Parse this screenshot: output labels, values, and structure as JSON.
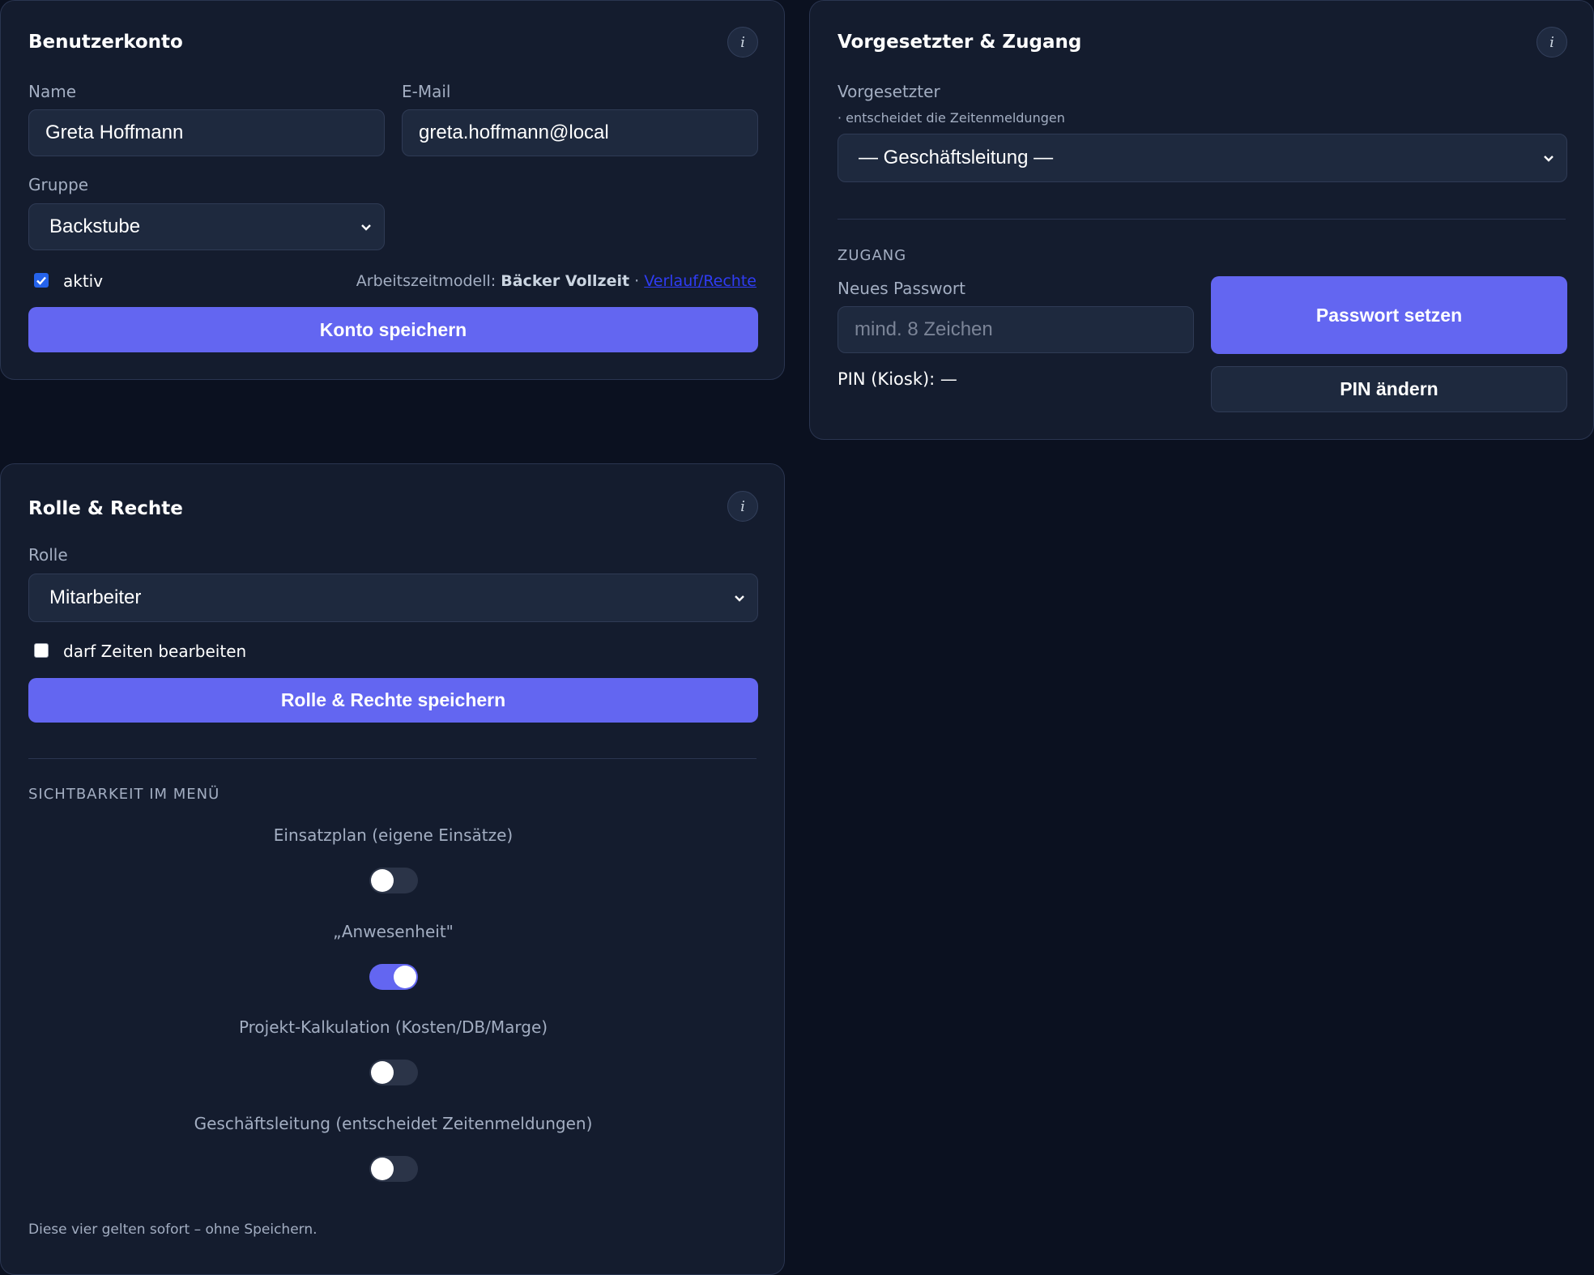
{
  "account": {
    "title": "Benutzerkonto",
    "info_label": "i",
    "name_label": "Name",
    "name_value": "Greta Hoffmann",
    "email_label": "E-Mail",
    "email_value": "greta.hoffmann@local",
    "group_label": "Gruppe",
    "group_value": "Backstube",
    "active_label": "aktiv",
    "active_checked": true,
    "model_prefix": "Arbeitszeitmodell:",
    "model_value": "Bäcker Vollzeit",
    "model_sep": "·",
    "history_link": "Verlauf/Rechte",
    "save_label": "Konto speichern"
  },
  "superior": {
    "title": "Vorgesetzter & Zugang",
    "info_label": "i",
    "superior_label": "Vorgesetzter",
    "superior_hint": "· entscheidet die Zeitenmeldungen",
    "superior_value": "— Geschäftsleitung —",
    "access_heading": "ZUGANG",
    "password_label": "Neues Passwort",
    "password_placeholder": "mind. 8 Zeichen",
    "set_password_label": "Passwort setzen",
    "pin_text": "PIN (Kiosk): —",
    "change_pin_label": "PIN ändern"
  },
  "role": {
    "title": "Rolle & Rechte",
    "info_label": "i",
    "role_label": "Rolle",
    "role_value": "Mitarbeiter",
    "edit_times_label": "darf Zeiten bearbeiten",
    "edit_times_checked": false,
    "save_label": "Rolle & Rechte speichern",
    "visibility_heading": "SICHTBARKEIT IM MENÜ",
    "toggles": [
      {
        "label": "Einsatzplan (eigene Einsätze)",
        "on": false
      },
      {
        "label": "„Anwesenheit\"",
        "on": true
      },
      {
        "label": "Projekt-Kalkulation (Kosten/DB/Marge)",
        "on": false
      },
      {
        "label": "Geschäftsleitung (entscheidet Zeitenmeldungen)",
        "on": false
      }
    ],
    "note": "Diese vier gelten sofort – ohne Speichern."
  },
  "colors": {
    "accent": "#6366f1",
    "background": "#0b1120",
    "card": "#141c2e",
    "link": "#2f3cf5"
  }
}
